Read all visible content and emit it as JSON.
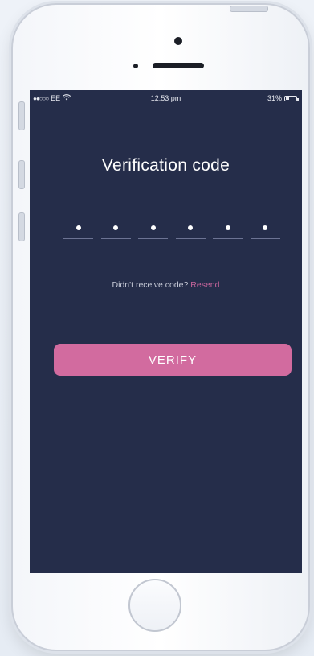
{
  "status_bar": {
    "carrier": "EE",
    "signal_dots": "●●○○○",
    "time": "12:53 pm",
    "battery_percent": "31%",
    "battery_level": 0.31,
    "wifi_icon": "wifi-icon"
  },
  "screen": {
    "title": "Verification code",
    "code_slots": [
      {
        "filled": true
      },
      {
        "filled": true
      },
      {
        "filled": true
      },
      {
        "filled": true
      },
      {
        "filled": true
      },
      {
        "filled": true
      }
    ],
    "resend_prompt": "Didn't receive code?",
    "resend_link": "Resend",
    "verify_button": "VERIFY"
  },
  "colors": {
    "screen_background": "#252d4a",
    "accent": "#d26b9f",
    "link": "#c8659c"
  }
}
